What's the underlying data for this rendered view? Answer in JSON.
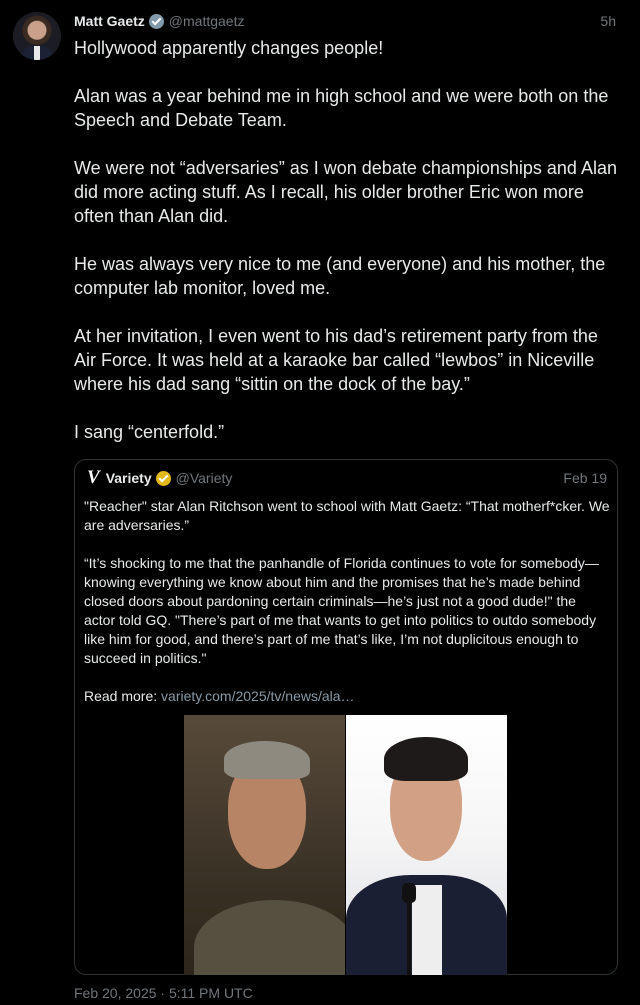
{
  "tweet": {
    "author_name": "Matt Gaetz",
    "author_handle": "@mattgaetz",
    "age": "5h",
    "paragraphs": [
      "Hollywood apparently changes people!",
      "Alan was a year behind me in high school and we were both on the Speech and Debate Team.",
      "We were not “adversaries” as I won debate championships and Alan did more acting stuff.  As I recall, his older brother Eric won more often than Alan did.",
      "He was always very nice to me (and everyone) and his mother, the computer lab monitor, loved me.",
      "At her invitation, I even went to his dad’s retirement party from the Air Force. It was held at a karaoke bar called “lewbos” in Niceville where his dad sang “sittin on the dock of the bay.”",
      "I sang “centerfold.”"
    ],
    "timestamp": "Feb 20, 2025 · 5:11 PM UTC"
  },
  "quote": {
    "logo_glyph": "V",
    "author_name": "Variety",
    "author_handle": "@Variety",
    "date": "Feb 19",
    "paragraph_1": "\"Reacher\" star Alan Ritchson went to school with Matt Gaetz: “That motherf*cker. We are adversaries.”",
    "paragraph_2": "“It’s shocking to me that the panhandle of Florida continues to vote for somebody—knowing everything we know about him and the promises that he’s made behind closed doors about pardoning certain criminals—he’s just not a good dude!\" the actor told GQ. \"There’s part of me that wants to get into politics to outdo somebody like him for good, and there’s part of me that’s like, I’m not duplicitous enough to succeed in politics.\"",
    "read_more_label": "Read more: ",
    "read_more_link": "variety.com/2025/tv/news/ala…"
  },
  "colors": {
    "background": "#000000",
    "text": "#e7e9ea",
    "muted": "#71767b",
    "border": "#2f3336",
    "gold_badge": "#e2b719",
    "gray_badge": "#829aab"
  }
}
